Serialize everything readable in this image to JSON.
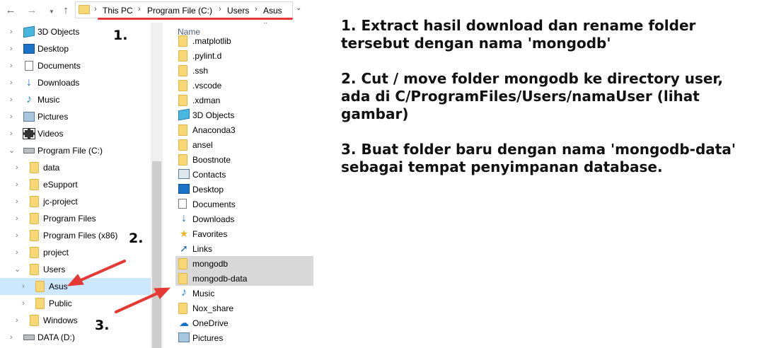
{
  "address_bar": {
    "back_icon": "arrow-left-icon",
    "forward_icon": "arrow-right-icon",
    "up_icon": "arrow-up-icon",
    "breadcrumbs": [
      "This PC",
      "Program File (C:)",
      "Users",
      "Asus"
    ],
    "highlight_color": "#e53935"
  },
  "nav_pane": {
    "items": [
      {
        "label": "3D Objects",
        "icon": "3d-objects-icon"
      },
      {
        "label": "Desktop",
        "icon": "desktop-icon"
      },
      {
        "label": "Documents",
        "icon": "documents-icon"
      },
      {
        "label": "Downloads",
        "icon": "downloads-icon"
      },
      {
        "label": "Music",
        "icon": "music-icon"
      },
      {
        "label": "Pictures",
        "icon": "pictures-icon"
      },
      {
        "label": "Videos",
        "icon": "videos-icon"
      },
      {
        "label": "Program File (C:)",
        "icon": "drive-icon",
        "expanded": true
      },
      {
        "label": "data",
        "icon": "folder-icon"
      },
      {
        "label": "eSupport",
        "icon": "folder-icon"
      },
      {
        "label": "jc-project",
        "icon": "folder-icon"
      },
      {
        "label": "Program Files",
        "icon": "folder-icon"
      },
      {
        "label": "Program Files (x86)",
        "icon": "folder-icon"
      },
      {
        "label": "project",
        "icon": "folder-icon"
      },
      {
        "label": "Users",
        "icon": "folder-icon",
        "expanded": true
      },
      {
        "label": "Asus",
        "icon": "folder-icon",
        "selected": true
      },
      {
        "label": "Public",
        "icon": "folder-icon"
      },
      {
        "label": "Windows",
        "icon": "folder-icon"
      },
      {
        "label": "DATA (D:)",
        "icon": "drive-icon"
      }
    ]
  },
  "file_list": {
    "column_header": "Name",
    "items": [
      {
        "label": ".matplotlib",
        "icon": "folder-icon"
      },
      {
        "label": ".pylint.d",
        "icon": "folder-icon"
      },
      {
        "label": ".ssh",
        "icon": "folder-icon"
      },
      {
        "label": ".vscode",
        "icon": "folder-icon"
      },
      {
        "label": ".xdman",
        "icon": "folder-icon"
      },
      {
        "label": "3D Objects",
        "icon": "3d-objects-icon"
      },
      {
        "label": "Anaconda3",
        "icon": "folder-icon"
      },
      {
        "label": "ansel",
        "icon": "folder-icon"
      },
      {
        "label": "Boostnote",
        "icon": "folder-icon"
      },
      {
        "label": "Contacts",
        "icon": "contacts-icon"
      },
      {
        "label": "Desktop",
        "icon": "desktop-icon"
      },
      {
        "label": "Documents",
        "icon": "documents-icon"
      },
      {
        "label": "Downloads",
        "icon": "downloads-icon"
      },
      {
        "label": "Favorites",
        "icon": "favorites-icon"
      },
      {
        "label": "Links",
        "icon": "links-icon"
      },
      {
        "label": "mongodb",
        "icon": "folder-icon",
        "selected": true
      },
      {
        "label": "mongodb-data",
        "icon": "folder-icon",
        "selected": true
      },
      {
        "label": "Music",
        "icon": "music-icon"
      },
      {
        "label": "Nox_share",
        "icon": "folder-icon"
      },
      {
        "label": "OneDrive",
        "icon": "onedrive-icon"
      },
      {
        "label": "Pictures",
        "icon": "pictures-icon"
      }
    ]
  },
  "annotations": {
    "marker_1": "1.",
    "marker_2": "2.",
    "marker_3": "3.",
    "arrow_color": "#e53935"
  },
  "instructions": {
    "step_1": "1. Extract hasil download dan rename folder tersebut dengan nama 'mongodb'",
    "step_2": "2. Cut / move folder mongodb ke directory user, ada di C/ProgramFiles/Users/namaUser (lihat gambar)",
    "step_3": "3. Buat folder baru dengan nama 'mongodb-data' sebagai tempat penyimpanan database."
  }
}
